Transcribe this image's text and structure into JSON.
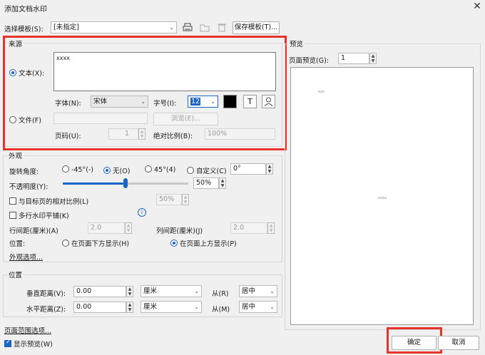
{
  "window": {
    "title": "添加文档水印",
    "close_icon": "✕"
  },
  "template": {
    "label": "选择模板(S):",
    "value": "[未指定]",
    "save_button": "保存模板(T)..."
  },
  "source": {
    "group_label": "来源",
    "text_radio": "文本(X):",
    "text_value": "xxxx",
    "font_label": "字体(N):",
    "font_value": "宋体",
    "size_label": "字号(I):",
    "size_value": "12",
    "color_value": "#000000",
    "file_radio": "文件(F)",
    "browse_button": "浏览(E)...",
    "page_label": "页码(U):",
    "page_value": "1",
    "scale_label": "绝对比例(B):",
    "scale_value": "100%"
  },
  "appearance": {
    "group_label": "外观",
    "rotation_label": "旋转角度:",
    "rot_neg45": "-45°(-)",
    "rot_none": "无(O)",
    "rot_45": "45°(4)",
    "rot_custom": "自定义(C)",
    "rot_custom_value": "0°",
    "opacity_label": "不透明度(Y):",
    "opacity_value": "50%",
    "opacity_level": 0.5,
    "relative_label": "与目标页的相对比例(L)",
    "relative_value": "50%",
    "tile_label": "多行水印平铺(K)",
    "row_spacing_label": "行间距(厘米)(A)",
    "row_spacing_value": "2.0",
    "col_spacing_label": "列间距(厘米)(J)",
    "col_spacing_value": "2.0",
    "position_label": "位置:",
    "below_label": "在页面下方显示(H)",
    "above_label": "在页面上方显示(P)",
    "options_link": "外观选项..."
  },
  "position": {
    "group_label": "位置",
    "vertical_label": "垂直距离(V):",
    "vertical_value": "0.00",
    "vertical_unit": "厘米",
    "vertical_from_label": "从(R)",
    "vertical_from_value": "居中",
    "horizontal_label": "水平距离(Z):",
    "horizontal_value": "0.00",
    "horizontal_unit": "厘米",
    "horizontal_from_label": "从(M)",
    "horizontal_from_value": "居中"
  },
  "page_range_link": "页面范围选项...",
  "show_preview_label": "显示预览(W)",
  "preview": {
    "group_label": "预览",
    "page_label": "页面预览(G):",
    "page_value": "1",
    "mark_small": "xxx",
    "mark_center": "xxxx"
  },
  "buttons": {
    "ok": "确定",
    "cancel": "取消"
  },
  "colors": {
    "accent": "#1a66c8",
    "highlight": "#e8332a"
  }
}
